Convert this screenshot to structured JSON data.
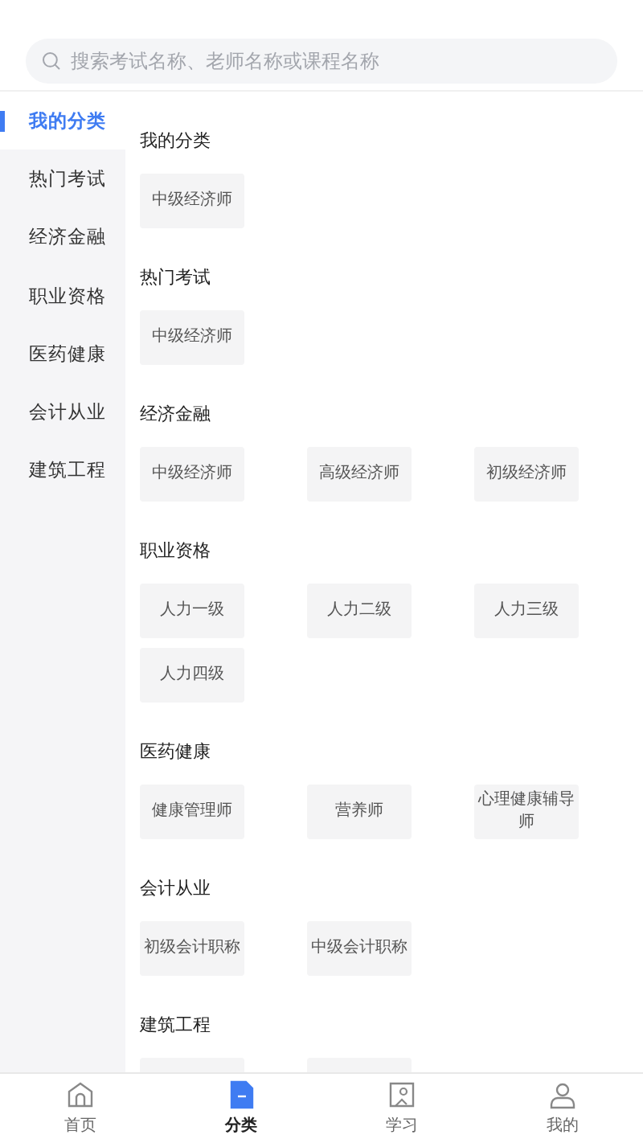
{
  "search": {
    "placeholder": "搜索考试名称、老师名称或课程名称"
  },
  "sidebar": {
    "items": [
      {
        "label": "我的分类",
        "selected": true
      },
      {
        "label": "热门考试",
        "selected": false
      },
      {
        "label": "经济金融",
        "selected": false
      },
      {
        "label": "职业资格",
        "selected": false
      },
      {
        "label": "医药健康",
        "selected": false
      },
      {
        "label": "会计从业",
        "selected": false
      },
      {
        "label": "建筑工程",
        "selected": false
      }
    ]
  },
  "sections": [
    {
      "title": "我的分类",
      "items": [
        {
          "kind": "tile",
          "label": "中级经济师"
        }
      ]
    },
    {
      "title": "热门考试",
      "items": [
        {
          "kind": "tile",
          "label": "中级经济师"
        }
      ]
    },
    {
      "title": "经济金融",
      "items": [
        {
          "kind": "tile",
          "label": "中级经济师"
        },
        {
          "kind": "tile",
          "label": "高级经济师"
        },
        {
          "kind": "tile",
          "label": "初级经济师"
        }
      ]
    },
    {
      "title": "职业资格",
      "items": [
        {
          "kind": "tile",
          "label": "人力一级"
        },
        {
          "kind": "tile",
          "label": "人力二级"
        },
        {
          "kind": "tile",
          "label": "人力三级"
        },
        {
          "kind": "tile",
          "label": "人力四级"
        }
      ]
    },
    {
      "title": "医药健康",
      "items": [
        {
          "kind": "tile",
          "label": "健康管理师"
        },
        {
          "kind": "tile",
          "label": "营养师"
        },
        {
          "kind": "tile",
          "label": "心理健康辅导师"
        }
      ]
    },
    {
      "title": "会计从业",
      "items": [
        {
          "kind": "tile",
          "label": "初级会计职称"
        },
        {
          "kind": "tile",
          "label": "中级会计职称"
        }
      ]
    },
    {
      "title": "建筑工程",
      "items": [
        {
          "kind": "covered"
        },
        {
          "kind": "covered"
        }
      ]
    }
  ],
  "tabbar": [
    {
      "kind": "home",
      "label": "首页",
      "selected": false
    },
    {
      "kind": "category",
      "label": "分类",
      "selected": true
    },
    {
      "kind": "study",
      "label": "学习",
      "selected": false
    },
    {
      "kind": "me",
      "label": "我的",
      "selected": false
    }
  ]
}
